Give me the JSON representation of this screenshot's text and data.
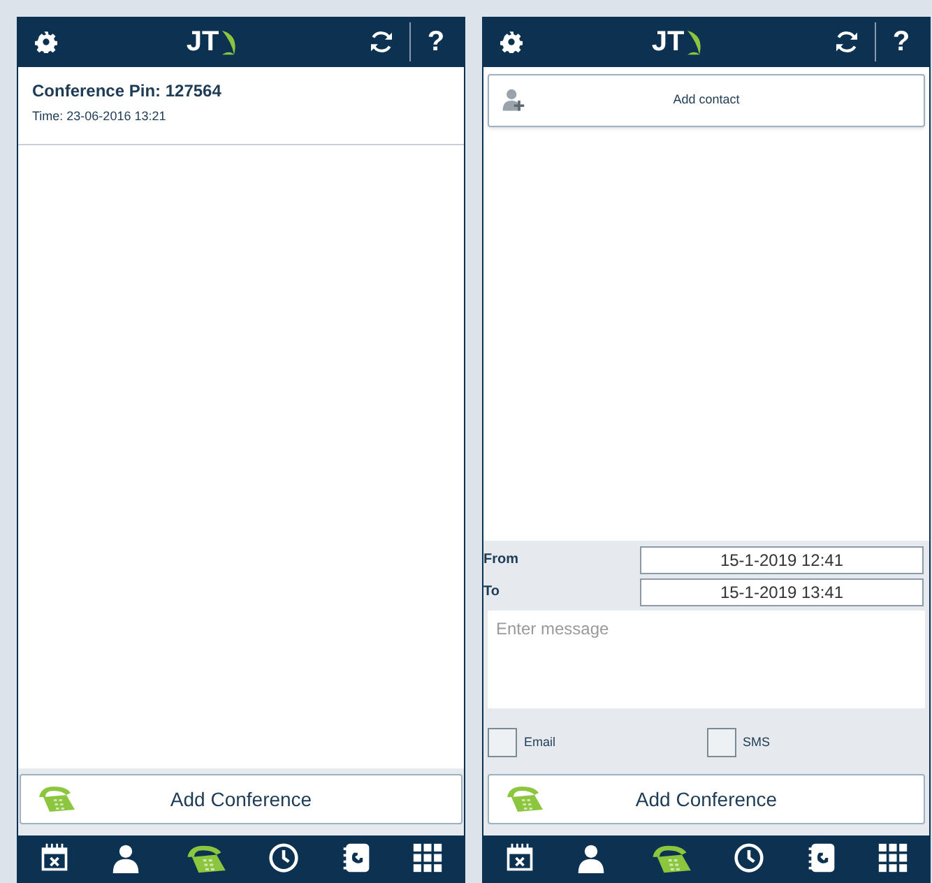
{
  "screens": [
    {
      "kind": "list",
      "header": {
        "logo": "JT",
        "help": "?"
      },
      "conferences": [
        {
          "pin": "Conference Pin: 127564",
          "time": "Time: 23-06-2016 13:21"
        }
      ],
      "add_button": "Add Conference",
      "nav": [
        {
          "kind": "absence",
          "selected": false
        },
        {
          "kind": "groups",
          "selected": false
        },
        {
          "kind": "conference",
          "selected": true
        },
        {
          "kind": "logs",
          "selected": false
        },
        {
          "kind": "contacts",
          "selected": false
        },
        {
          "kind": "call",
          "selected": false
        }
      ]
    },
    {
      "kind": "form",
      "header": {
        "logo": "JT",
        "help": "?"
      },
      "add_contact": "Add contact",
      "from": {
        "label": "From",
        "value": "15-1-2019 12:41"
      },
      "to": {
        "label": "To",
        "value": "15-1-2019 13:41"
      },
      "message": {
        "placeholder": "Enter message"
      },
      "options": [
        {
          "label": "Email",
          "checked": false
        },
        {
          "label": "SMS",
          "checked": false
        }
      ],
      "add_button": "Add Conference",
      "nav": [
        {
          "kind": "absence",
          "selected": false
        },
        {
          "kind": "groups",
          "selected": false
        },
        {
          "kind": "conference",
          "selected": true
        },
        {
          "kind": "logs",
          "selected": false
        },
        {
          "kind": "contacts",
          "selected": false
        },
        {
          "kind": "call",
          "selected": false
        }
      ]
    }
  ]
}
